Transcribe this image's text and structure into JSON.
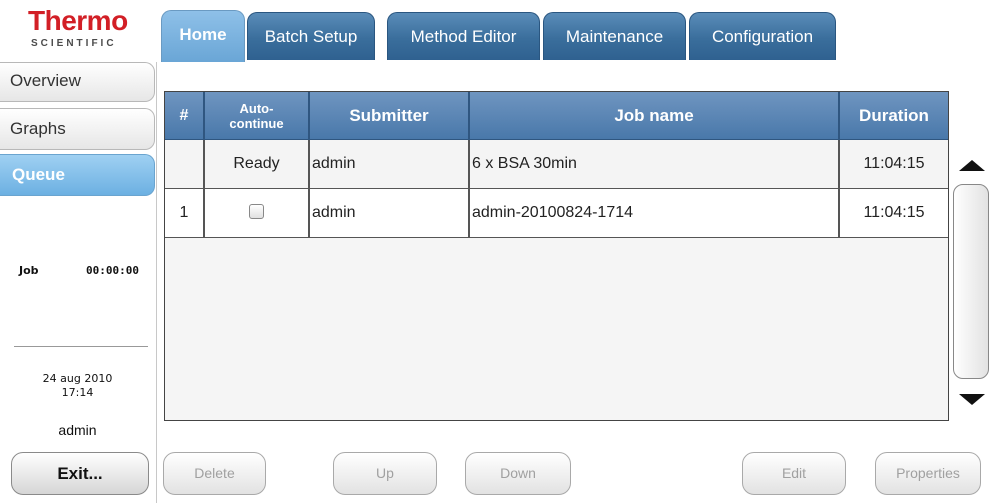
{
  "logo": {
    "main": "Thermo",
    "sub": "SCIENTIFIC"
  },
  "tabs": [
    {
      "label": "Home",
      "active": true
    },
    {
      "label": "Batch Setup",
      "active": false
    },
    {
      "label": "Method Editor",
      "active": false
    },
    {
      "label": "Maintenance",
      "active": false
    },
    {
      "label": "Configuration",
      "active": false
    }
  ],
  "sidebar": {
    "items": [
      {
        "label": "Overview",
        "active": false
      },
      {
        "label": "Graphs",
        "active": false
      },
      {
        "label": "Queue",
        "active": true
      }
    ],
    "job_label": "Job",
    "job_time": "00:00:00",
    "date": "24 aug 2010",
    "time": "17:14",
    "user": "admin",
    "exit_label": "Exit..."
  },
  "table": {
    "columns": [
      "#",
      "Auto-\ncontinue",
      "Submitter",
      "Job name",
      "Duration"
    ],
    "rows": [
      {
        "num": "",
        "auto": "Ready",
        "submitter": "admin",
        "job_name": "6 x BSA 30min",
        "duration": "11:04:15"
      },
      {
        "num": "1",
        "auto": "",
        "submitter": "admin",
        "job_name": "admin-20100824-1714",
        "duration": "11:04:15"
      }
    ]
  },
  "buttons": {
    "delete": "Delete",
    "up": "Up",
    "down": "Down",
    "edit": "Edit",
    "properties": "Properties"
  },
  "colors": {
    "brand_red": "#d21f26",
    "tab_blue": "#3a6e9c",
    "active_light_blue": "#6cb0e2",
    "header_blue": "#5a84b5"
  }
}
